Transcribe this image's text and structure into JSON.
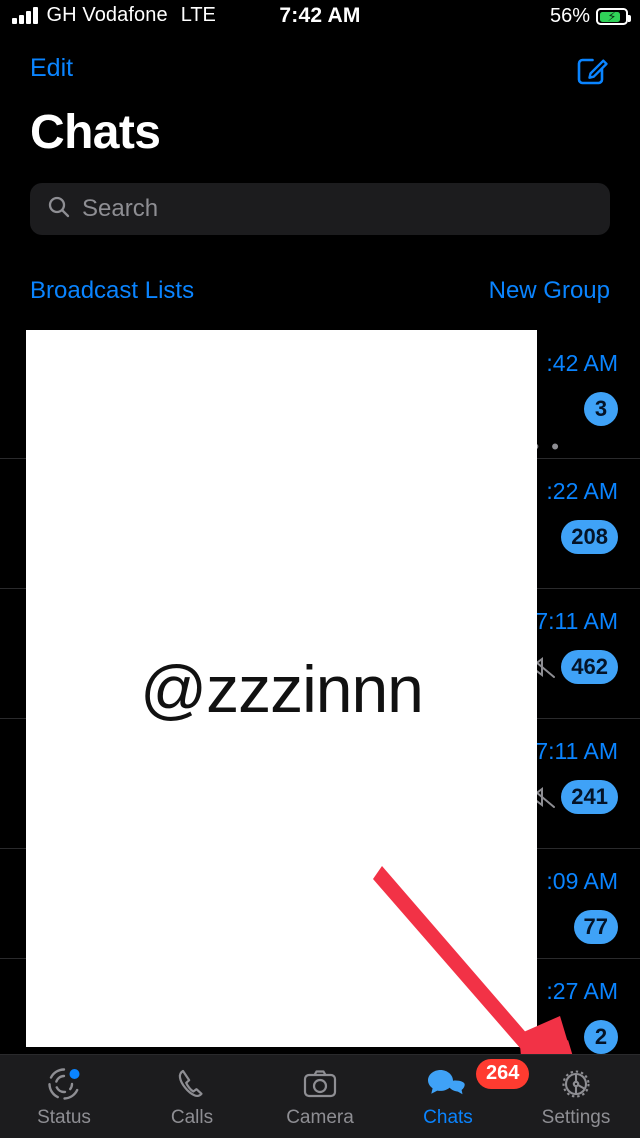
{
  "status_bar": {
    "carrier": "GH Vodafone",
    "network": "LTE",
    "time": "7:42 AM",
    "battery_percent": "56%",
    "battery_charging": true,
    "signal_icon": "signal-bars-icon",
    "battery_icon": "battery-charging-icon"
  },
  "nav": {
    "edit_label": "Edit",
    "compose_icon": "compose-icon",
    "title": "Chats"
  },
  "search": {
    "placeholder": "Search",
    "value": "",
    "icon": "search-icon"
  },
  "quick_links": {
    "broadcast_label": "Broadcast Lists",
    "new_group_label": "New Group"
  },
  "chat_rows": [
    {
      "time": ":42 AM",
      "badge": "3",
      "muted": false,
      "typing": "• • •"
    },
    {
      "time": ":22 AM",
      "badge": "208",
      "muted": false,
      "typing": ""
    },
    {
      "time": "7:11 AM",
      "badge": "462",
      "muted": true,
      "typing": ""
    },
    {
      "time": "7:11 AM",
      "badge": "241",
      "muted": true,
      "typing": ""
    },
    {
      "time": ":09 AM",
      "badge": "77",
      "muted": false,
      "typing": ""
    },
    {
      "time": ":27 AM",
      "badge": "2",
      "muted": false,
      "typing": ""
    }
  ],
  "overlay": {
    "watermark": "@zzzinnn"
  },
  "annotation": {
    "arrow_icon": "red-arrow-icon",
    "arrow_color": "#F23246",
    "points_to": "Settings"
  },
  "tab_bar": {
    "tabs": [
      {
        "label": "Status",
        "icon": "status-rings-icon",
        "active": false,
        "badge": "",
        "dot": true
      },
      {
        "label": "Calls",
        "icon": "phone-icon",
        "active": false,
        "badge": "",
        "dot": false
      },
      {
        "label": "Camera",
        "icon": "camera-icon",
        "active": false,
        "badge": "",
        "dot": false
      },
      {
        "label": "Chats",
        "icon": "chat-bubbles-icon",
        "active": true,
        "badge": "264",
        "dot": false
      },
      {
        "label": "Settings",
        "icon": "gear-icon",
        "active": false,
        "badge": "",
        "dot": false
      }
    ]
  },
  "colors": {
    "background": "#000000",
    "accent_blue": "#0A84FF",
    "badge_blue": "#3FA2F7",
    "badge_red": "#FF3B30",
    "field_gray": "#1C1C1E",
    "muted_text": "#8E8E93",
    "battery_green": "#30D158"
  }
}
